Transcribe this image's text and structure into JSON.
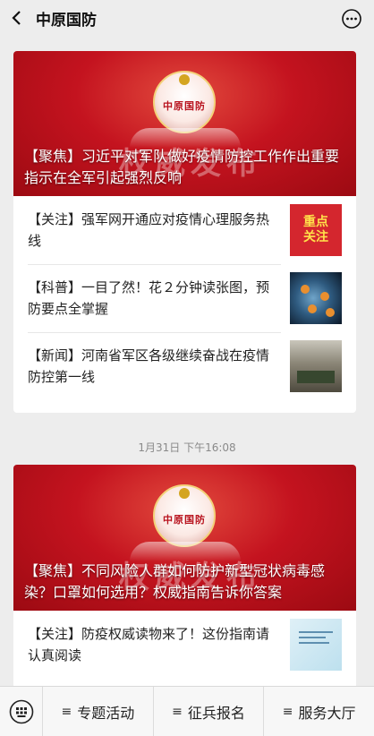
{
  "header": {
    "title": "中原国防",
    "back_icon": "chevron-left-icon",
    "more_icon": "more-dots-icon"
  },
  "cards": [
    {
      "hero": {
        "logo_text": "中原国防",
        "caption": "【聚焦】习近平对军队做好疫情防控工作作出重要指示在全军引起强烈反响",
        "watermark": "权威发布"
      },
      "items": [
        {
          "text": "【关注】强军网开通应对疫情心理服务热线",
          "thumb_lines": [
            "重点",
            "关注"
          ]
        },
        {
          "text": "【科普】一目了然！花２分钟读张图，预防要点全掌握"
        },
        {
          "text": "【新闻】河南省军区各级继续奋战在疫情防控第一线"
        }
      ]
    },
    {
      "hero": {
        "logo_text": "中原国防",
        "caption": "【聚焦】不同风险人群如何防护新型冠状病毒感染？口罩如何选用？权威指南告诉你答案",
        "watermark": "权威发布"
      },
      "items": [
        {
          "text": "【关注】防疫权威读物来了！这份指南请认真阅读"
        }
      ]
    }
  ],
  "timestamp": "1月31日 下午16:08",
  "bottom_menu": {
    "keyboard_icon": "keyboard-icon",
    "items": [
      {
        "label": "专题活动"
      },
      {
        "label": "征兵报名"
      },
      {
        "label": "服务大厅"
      }
    ],
    "menu_icon_glyph": "≡"
  },
  "colors": {
    "accent_red": "#c4131f",
    "background": "#ededed"
  }
}
